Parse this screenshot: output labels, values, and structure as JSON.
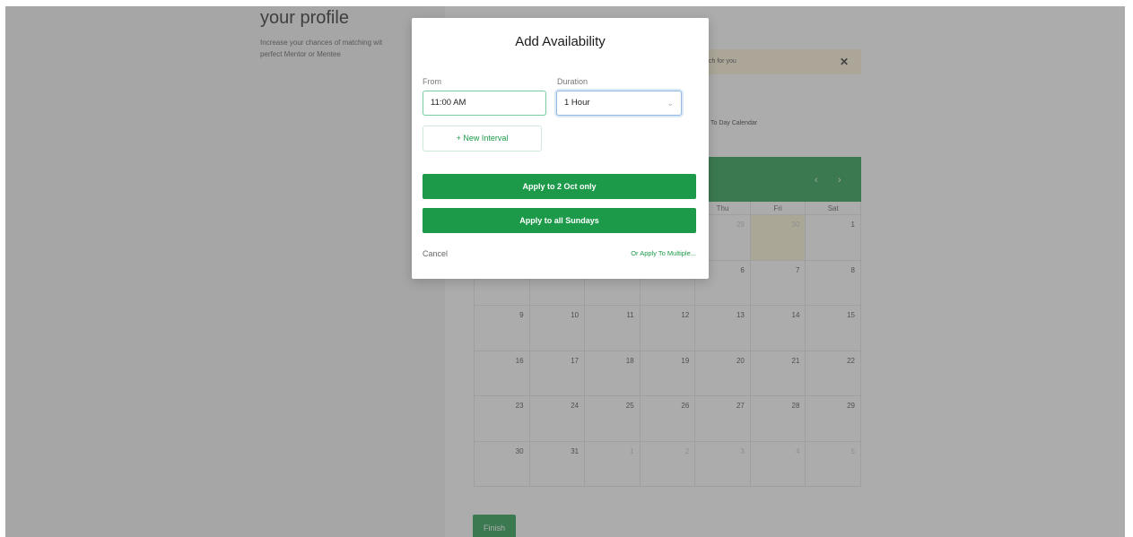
{
  "background": {
    "profile_title": "your profile",
    "profile_subtitle_line1": "Increase your chances of matching wit",
    "profile_subtitle_line2": "perfect Mentor or Mentee",
    "banner_text": "ch for you",
    "banner_close_icon": "close-icon",
    "calendar_link": "To Day Calendar",
    "finish_label": "Finish"
  },
  "calendar": {
    "prev_icon": "‹",
    "next_icon": "›",
    "weekdays": [
      "",
      "",
      "",
      "",
      "Thu",
      "Fri",
      "Sat"
    ],
    "weeks": [
      [
        {
          "d": ""
        },
        {
          "d": ""
        },
        {
          "d": ""
        },
        {
          "d": ""
        },
        {
          "d": "29",
          "muted": true
        },
        {
          "d": "30",
          "muted": true,
          "hl": true
        },
        {
          "d": "1"
        }
      ],
      [
        {
          "d": ""
        },
        {
          "d": ""
        },
        {
          "d": ""
        },
        {
          "d": ""
        },
        {
          "d": "6"
        },
        {
          "d": "7"
        },
        {
          "d": "8"
        }
      ],
      [
        {
          "d": "9"
        },
        {
          "d": "10"
        },
        {
          "d": "11"
        },
        {
          "d": "12"
        },
        {
          "d": "13"
        },
        {
          "d": "14"
        },
        {
          "d": "15"
        }
      ],
      [
        {
          "d": "16"
        },
        {
          "d": "17"
        },
        {
          "d": "18"
        },
        {
          "d": "19"
        },
        {
          "d": "20"
        },
        {
          "d": "21"
        },
        {
          "d": "22"
        }
      ],
      [
        {
          "d": "23"
        },
        {
          "d": "24"
        },
        {
          "d": "25"
        },
        {
          "d": "26"
        },
        {
          "d": "27"
        },
        {
          "d": "28"
        },
        {
          "d": "29"
        }
      ],
      [
        {
          "d": "30"
        },
        {
          "d": "31"
        },
        {
          "d": "1",
          "muted": true
        },
        {
          "d": "2",
          "muted": true
        },
        {
          "d": "3",
          "muted": true
        },
        {
          "d": "4",
          "muted": true
        },
        {
          "d": "5",
          "muted": true
        }
      ]
    ]
  },
  "modal": {
    "title": "Add Availability",
    "from_label": "From",
    "from_value": "11:00 AM",
    "duration_label": "Duration",
    "duration_value": "1 Hour",
    "duration_chevron": "⌄",
    "new_interval_label": "+ New Interval",
    "apply_one_label": "Apply to 2 Oct only",
    "apply_all_label": "Apply to all Sundays",
    "cancel_label": "Cancel",
    "apply_multiple_label": "Or Apply To Multiple..."
  },
  "colors": {
    "accent_green": "#1c9a49",
    "highlight_yellow": "#fcf4d4",
    "overlay": "rgba(90,90,90,0.5)"
  }
}
